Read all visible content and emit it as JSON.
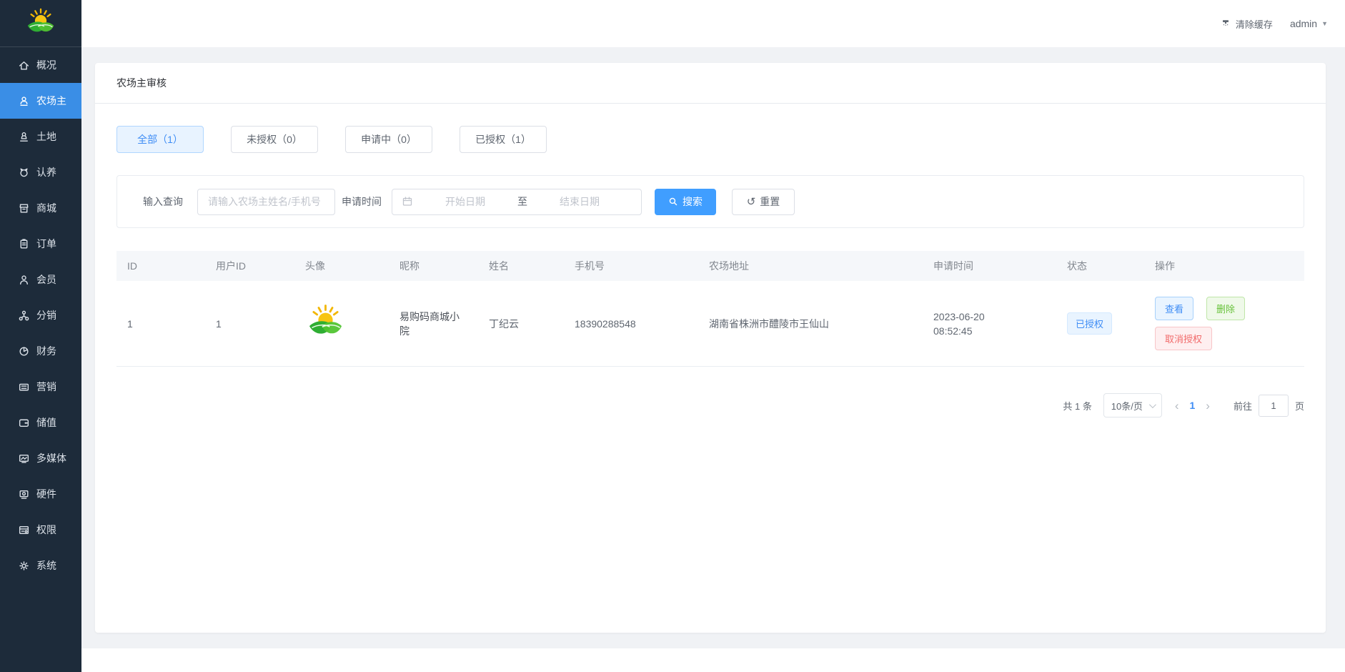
{
  "header": {
    "clear_cache_label": "清除缓存",
    "username": "admin"
  },
  "sidebar": {
    "items": [
      {
        "label": "概况",
        "icon": "home-icon"
      },
      {
        "label": "农场主",
        "icon": "farmer-icon"
      },
      {
        "label": "土地",
        "icon": "land-icon"
      },
      {
        "label": "认养",
        "icon": "adoption-icon"
      },
      {
        "label": "商城",
        "icon": "mall-icon"
      },
      {
        "label": "订单",
        "icon": "order-icon"
      },
      {
        "label": "会员",
        "icon": "member-icon"
      },
      {
        "label": "分销",
        "icon": "distribution-icon"
      },
      {
        "label": "财务",
        "icon": "finance-icon"
      },
      {
        "label": "营销",
        "icon": "marketing-icon"
      },
      {
        "label": "储值",
        "icon": "wallet-icon"
      },
      {
        "label": "多媒体",
        "icon": "media-icon"
      },
      {
        "label": "硬件",
        "icon": "hardware-icon"
      },
      {
        "label": "权限",
        "icon": "permission-icon"
      },
      {
        "label": "系统",
        "icon": "gear-icon"
      }
    ]
  },
  "page": {
    "title": "农场主审核",
    "tabs": [
      {
        "label": "全部（1）",
        "active": true
      },
      {
        "label": "未授权（0）",
        "active": false
      },
      {
        "label": "申请中（0）",
        "active": false
      },
      {
        "label": "已授权（1）",
        "active": false
      }
    ],
    "filter": {
      "query_label": "输入查询",
      "query_placeholder": "请输入农场主姓名/手机号",
      "time_label": "申请时间",
      "start_placeholder": "开始日期",
      "separator": "至",
      "end_placeholder": "结束日期",
      "search_label": "搜索",
      "reset_label": "重置"
    },
    "table": {
      "columns": [
        "ID",
        "用户ID",
        "头像",
        "昵称",
        "姓名",
        "手机号",
        "农场地址",
        "申请时间",
        "状态",
        "操作"
      ],
      "rows": [
        {
          "id": "1",
          "user_id": "1",
          "nickname": "易购码商城小院",
          "name": "丁纪云",
          "phone": "18390288548",
          "address": "湖南省株洲市醴陵市王仙山",
          "apply_date": "2023-06-20",
          "apply_time": "08:52:45",
          "status": "已授权",
          "actions": {
            "view": "查看",
            "delete": "删除",
            "cancel": "取消授权"
          }
        }
      ]
    },
    "pagination": {
      "total": "共 1 条",
      "page_size": "10条/页",
      "current_page": "1",
      "goto_label": "前往",
      "goto_value": "1",
      "page_unit": "页"
    }
  },
  "colors": {
    "primary": "#409eff",
    "sidebar_bg": "#1d2b3a",
    "sidebar_active_bg": "#3a8ee6",
    "page_bg": "#f0f2f5",
    "success": "#67c23a",
    "danger": "#f56c6c",
    "status_tag_bg": "#e9f4ff"
  }
}
